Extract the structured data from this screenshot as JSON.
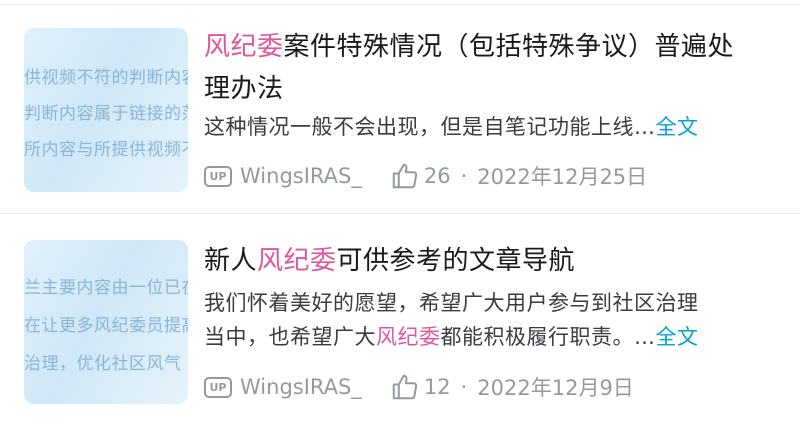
{
  "cards": [
    {
      "thumb_lines": [
        "供视频不符的判断内容",
        "判断内容属于链接的范",
        "所内容与所提供视频不"
      ],
      "title_highlight": "风纪委",
      "title_rest_line1": "案件特殊情况（包括特殊争议）普遍处",
      "title_line2": "理办法",
      "excerpt": "这种情况一般不会出现，但是自笔记功能上线…",
      "more": "全文",
      "up_badge": "UP",
      "author": "WingsIRAS_",
      "likes": "26",
      "separator": "·",
      "date": "2022年12月25日"
    },
    {
      "thumb_lines": [
        "兰主要内容由一位已在",
        "在让更多风纪委员提高",
        "治理，优化社区风气"
      ],
      "title_prefix": "新人",
      "title_highlight": "风纪委",
      "title_suffix": "可供参考的文章导航",
      "excerpt_line1": "我们怀着美好的愿望，希望广大用户参与到社区治理",
      "excerpt_line2_a": "当中，也希望广大",
      "excerpt_line2_highlight": "风纪委",
      "excerpt_line2_b": "都能积极履行职责。…",
      "more": "全文",
      "up_badge": "UP",
      "author": "WingsIRAS_",
      "likes": "12",
      "separator": "·",
      "date": "2022年12月9日"
    }
  ],
  "colors": {
    "highlight": "#e3559b",
    "link": "#00a1d6",
    "meta": "#9499a0"
  },
  "icons": {
    "uploader": "up-badge-icon",
    "like": "thumbs-up-icon"
  }
}
